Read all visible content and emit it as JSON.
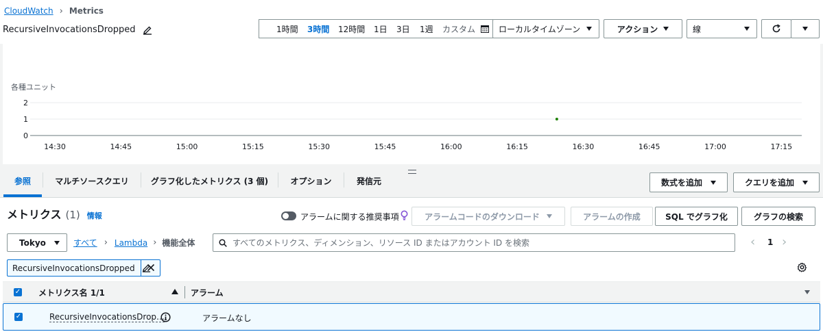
{
  "breadcrumb": {
    "root": "CloudWatch",
    "current": "Metrics"
  },
  "page_title": "RecursiveInvocationsDropped",
  "time_ranges": [
    "1時間",
    "3時間",
    "12時間",
    "1日",
    "3日",
    "1週",
    "カスタム"
  ],
  "active_time_range": "3時間",
  "timezone_label": "ローカルタイムゾーン",
  "actions_label": "アクション",
  "graph_type": "線",
  "chart_data": {
    "type": "scatter",
    "ylabel": "各種ユニット",
    "yticks": [
      "2",
      "1",
      "0"
    ],
    "ylim": [
      0,
      2
    ],
    "xticks": [
      "14:30",
      "14:45",
      "15:00",
      "15:15",
      "15:30",
      "15:45",
      "16:00",
      "16:15",
      "16:30",
      "16:45",
      "17:00",
      "17:15"
    ],
    "series": [
      {
        "x": [
          "16:24"
        ],
        "y": [
          1
        ],
        "color": "#1d8102"
      }
    ]
  },
  "tabs": [
    "参照",
    "マルチソースクエリ",
    "グラフ化したメトリクス (3 個)",
    "オプション",
    "発信元"
  ],
  "add_math_label": "数式を追加",
  "add_query_label": "クエリを追加",
  "metrics_section": {
    "title": "メトリクス",
    "count": "(1)",
    "info": "情報",
    "alarm_recommend": "アラームに関する推奨事項",
    "download_alarm_code": "アラームコードのダウンロード",
    "create_alarm": "アラームの作成",
    "graph_with_sql": "SQL でグラフ化",
    "graph_search": "グラフの検索"
  },
  "region": "Tokyo",
  "nav": {
    "all": "すべて",
    "lambda": "Lambda",
    "scope": "機能全体"
  },
  "search_placeholder": "すべてのメトリクス、ディメンション、リソース ID またはアカウント ID を検索",
  "pagination": {
    "page": "1"
  },
  "filter_chip": "RecursiveInvocationsDropped",
  "table": {
    "col_metric_name": "メトリクス名 1/1",
    "col_alarm": "アラーム",
    "rows": [
      {
        "metric": "RecursiveInvocationsDrop…",
        "alarm": "アラームなし"
      }
    ]
  }
}
